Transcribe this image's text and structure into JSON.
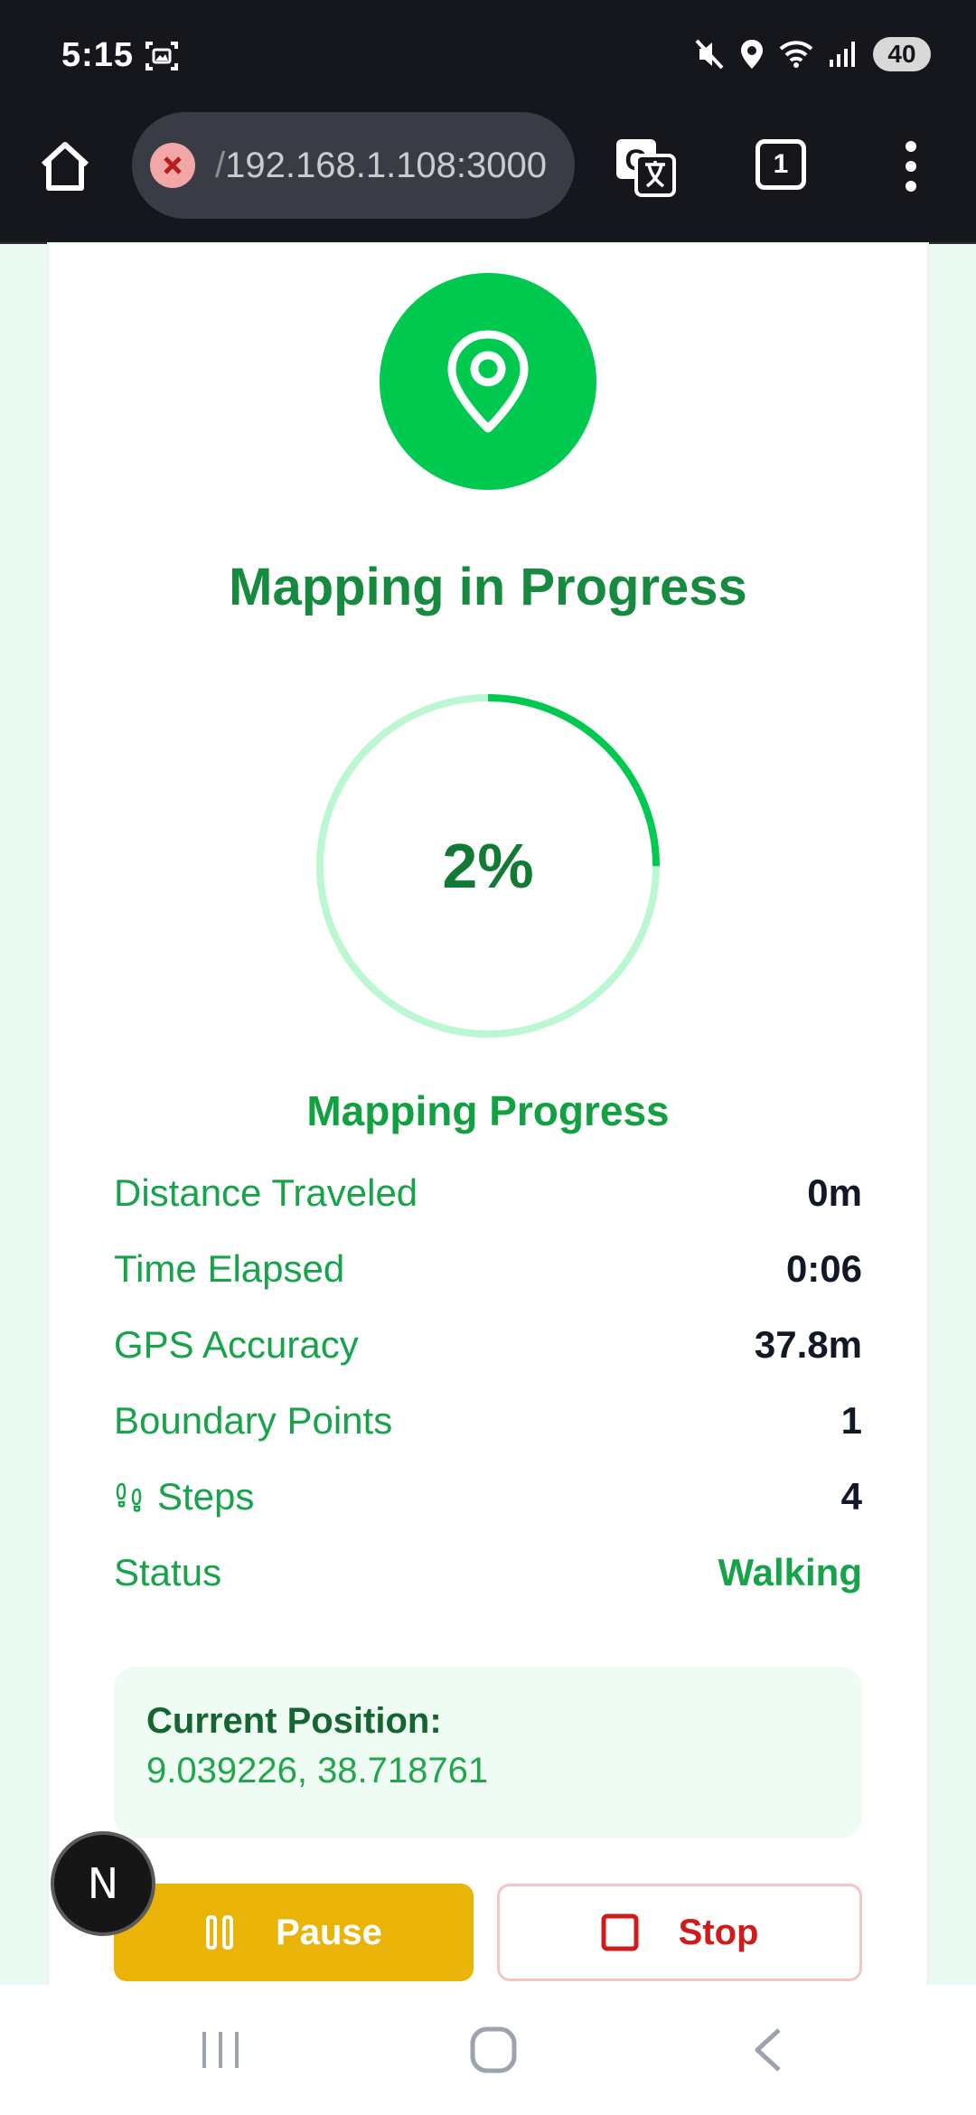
{
  "status_bar": {
    "time": "5:15",
    "icons": [
      "screenshot-icon",
      "mute-icon",
      "location-icon",
      "wifi-icon",
      "signal-icon"
    ],
    "battery": "40"
  },
  "browser": {
    "url_prefix": "/",
    "url": "192.168.1.108:3000",
    "tab_count": "1",
    "icons": [
      "home-icon",
      "insecure-icon",
      "translate-icon",
      "more-vert-icon"
    ]
  },
  "mapping": {
    "title": "Mapping in Progress",
    "progress_percent": 2,
    "progress_text": "2%",
    "progress_label": "Mapping Progress",
    "stats": [
      {
        "label": "Distance Traveled",
        "value": "0m"
      },
      {
        "label": "Time Elapsed",
        "value": "0:06"
      },
      {
        "label": "GPS Accuracy",
        "value": "37.8m"
      },
      {
        "label": "Boundary Points",
        "value": "1"
      },
      {
        "label": "Steps",
        "value": "4"
      },
      {
        "label": "Status",
        "value": "Walking"
      }
    ],
    "position_title": "Current Position:",
    "position_value": "9.039226, 38.718761",
    "pause_label": "Pause",
    "stop_label": "Stop"
  },
  "overlay": {
    "badge_letter": "N"
  },
  "colors": {
    "accent": "#00c950",
    "pause": "#eab308",
    "stop": "#d11a1a"
  }
}
